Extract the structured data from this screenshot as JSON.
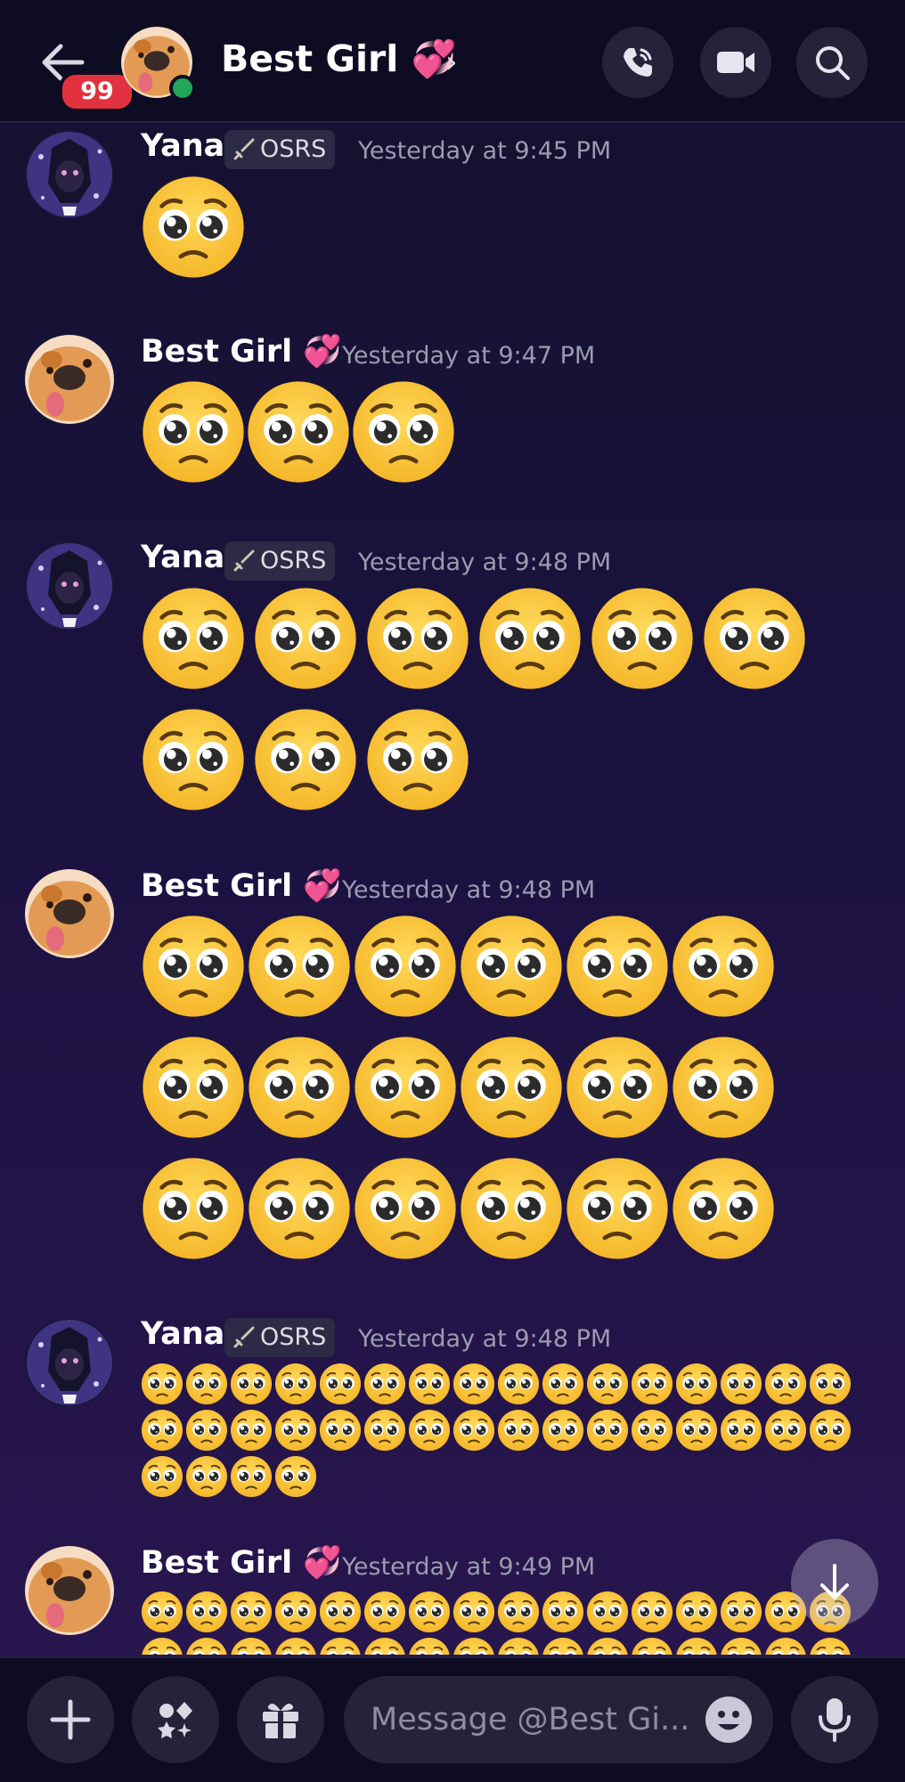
{
  "header": {
    "unread_badge": "99",
    "title": "Best Girl 💞",
    "chevron": "›",
    "icons": {
      "back": "arrow-left-icon",
      "call": "phone-call-icon",
      "video": "video-camera-icon",
      "search": "search-icon"
    }
  },
  "messages": [
    {
      "author": "Yana",
      "role_tag": "OSRS",
      "timestamp": "Yesterday at 9:45 PM",
      "emoji_rows": [
        1
      ],
      "emoji_size": "large"
    },
    {
      "author": "Best Girl 💞",
      "role_tag": "",
      "timestamp": "Yesterday at 9:47 PM",
      "emoji_rows": [
        3
      ],
      "emoji_size": "large"
    },
    {
      "author": "Yana",
      "role_tag": "OSRS",
      "timestamp": "Yesterday at 9:48 PM",
      "emoji_rows": [
        6,
        3
      ],
      "emoji_size": "large"
    },
    {
      "author": "Best Girl 💞",
      "role_tag": "",
      "timestamp": "Yesterday at 9:48 PM",
      "emoji_rows": [
        6,
        6,
        6
      ],
      "emoji_size": "large"
    },
    {
      "author": "Yana",
      "role_tag": "OSRS",
      "timestamp": "Yesterday at 9:48 PM",
      "emoji_rows": [
        16,
        16,
        4
      ],
      "emoji_size": "small"
    },
    {
      "author": "Best Girl 💞",
      "role_tag": "",
      "timestamp": "Yesterday at 9:49 PM",
      "emoji_rows": [
        16,
        16
      ],
      "emoji_size": "small"
    }
  ],
  "emoji": "pleading-face",
  "composer": {
    "placeholder": "Message @Best Gi...",
    "icons": {
      "add": "plus-icon",
      "apps": "apps-icon",
      "gift": "gift-icon",
      "emoji": "smiley-icon",
      "voice": "microphone-icon"
    }
  },
  "colors": {
    "header_bg": "#0d0c22",
    "button_bg": "#24233a",
    "timestamp": "#9a9bb0",
    "badge": "#e2323f",
    "online": "#23a55a",
    "emoji_face": "#fbc93a"
  }
}
